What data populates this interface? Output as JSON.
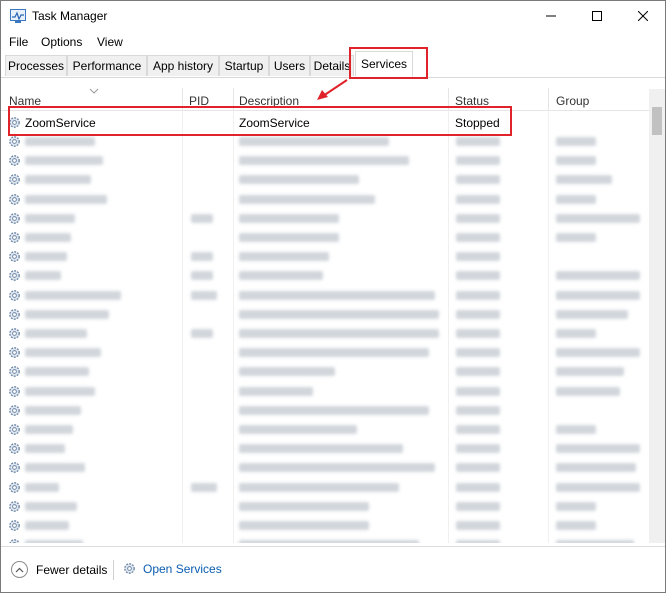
{
  "window": {
    "title": "Task Manager"
  },
  "menu": [
    "File",
    "Options",
    "View"
  ],
  "tabs": [
    "Processes",
    "Performance",
    "App history",
    "Startup",
    "Users",
    "Details",
    "Services"
  ],
  "active_tab": "Services",
  "columns": {
    "name": "Name",
    "pid": "PID",
    "description": "Description",
    "status": "Status",
    "group": "Group"
  },
  "highlight_row": {
    "name": "ZoomService",
    "pid": "",
    "description": "ZoomService",
    "status": "Stopped",
    "group": ""
  },
  "footer": {
    "fewer_details": "Fewer details",
    "open_services": "Open Services"
  },
  "colors": {
    "annotation": "#e0222a",
    "link": "#0a5db0"
  },
  "icons": [
    "task-manager-app-icon",
    "minimize-icon",
    "maximize-icon",
    "close-icon",
    "service-gear-icon",
    "chevron-up-icon",
    "open-services-gear-icon"
  ]
}
